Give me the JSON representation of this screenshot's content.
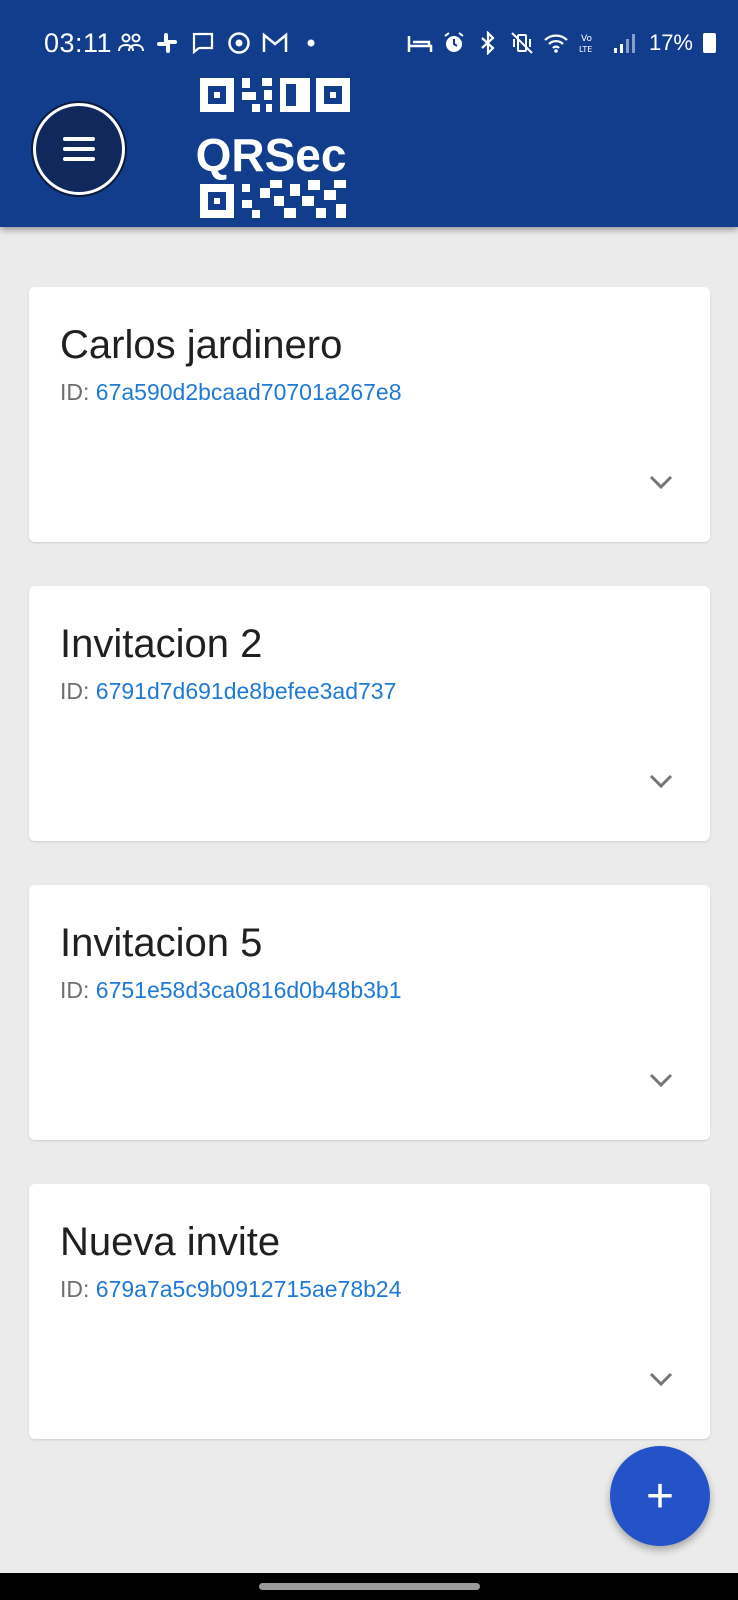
{
  "status_bar": {
    "time": "03:11",
    "battery": "17%",
    "left_icons": [
      "group-icon",
      "slack-icon",
      "message-icon",
      "chrome-icon",
      "gmail-icon",
      "dot-icon"
    ],
    "right_icons": [
      "sleep-icon",
      "alarm-icon",
      "bluetooth-icon",
      "vibrate-icon",
      "wifi-icon",
      "volte-icon",
      "signal-icon"
    ]
  },
  "header": {
    "logo_text": "QRSec",
    "background": "#123d8c"
  },
  "invitations": [
    {
      "title": "Carlos jardinero",
      "id_label": "ID:",
      "id_value": "67a590d2bcaad70701a267e8"
    },
    {
      "title": "Invitacion 2",
      "id_label": "ID:",
      "id_value": "6791d7d691de8befee3ad737"
    },
    {
      "title": "Invitacion 5",
      "id_label": "ID:",
      "id_value": "6751e58d3ca0816d0b48b3b1"
    },
    {
      "title": "Nueva invite",
      "id_label": "ID:",
      "id_value": "679a7a5c9b0912715ae78b24"
    }
  ],
  "fab": {
    "label": "+",
    "color": "#2452c7"
  },
  "colors": {
    "accent": "#1f7ad4"
  }
}
